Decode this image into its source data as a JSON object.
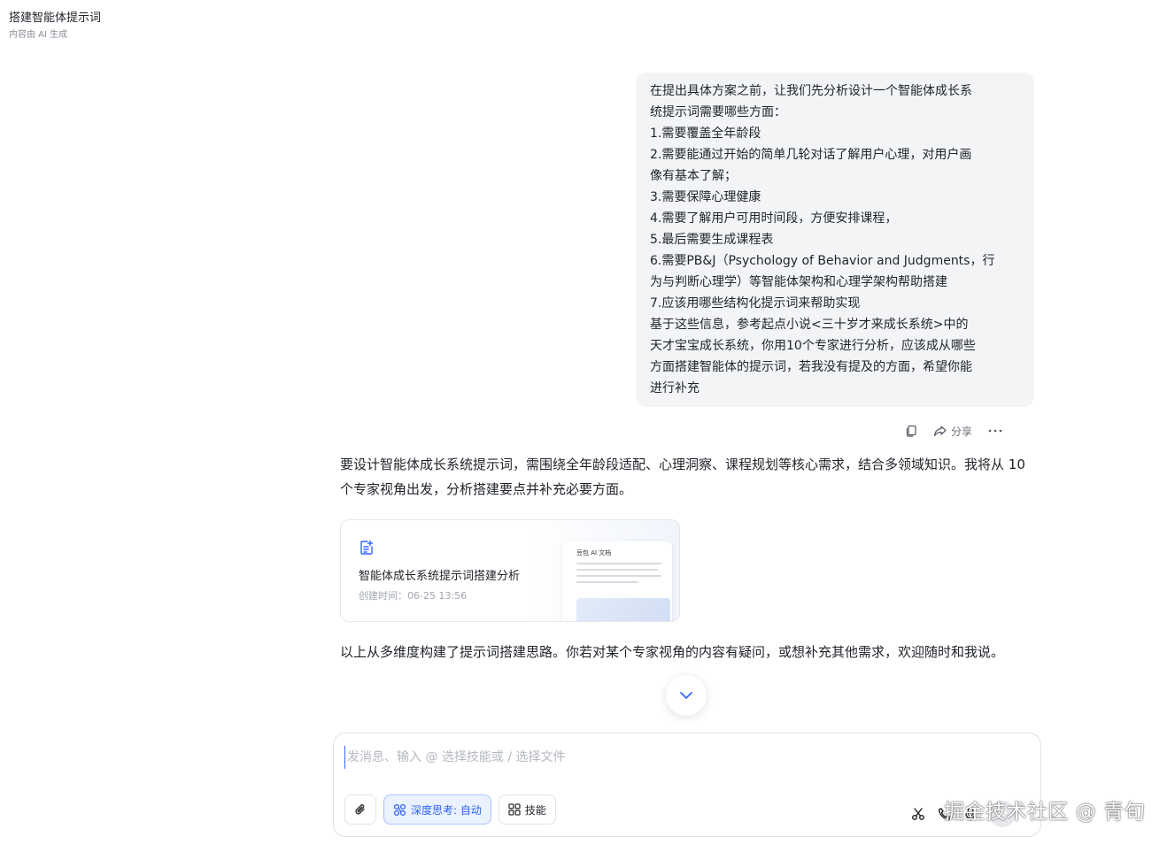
{
  "header": {
    "title": "搭建智能体提示词",
    "subtitle": "内容由 AI 生成"
  },
  "user_message": {
    "lines": [
      "在提出具体方案之前，让我们先分析设计一个智能体成长系",
      "统提示词需要哪些方面：",
      "1.需要覆盖全年龄段",
      "2.需要能通过开始的简单几轮对话了解用户心理，对用户画",
      "像有基本了解；",
      "3.需要保障心理健康",
      "4.需要了解用户可用时间段，方便安排课程，",
      "5.最后需要生成课程表",
      "6.需要PB&J（Psychology of Behavior and Judgments，行",
      "为与判断心理学）等智能体架构和心理学架构帮助搭建",
      "7.应该用哪些结构化提示词来帮助实现",
      "基于这些信息，参考起点小说<三十岁才来成长系统>中的",
      "天才宝宝成长系统，你用10个专家进行分析，应该成从哪些",
      "方面搭建智能体的提示词，若我没有提及的方面，希望你能",
      "进行补充"
    ]
  },
  "message_actions": {
    "share_label": "分享"
  },
  "assistant": {
    "intro": "要设计智能体成长系统提示词，需围绕全年龄段适配、心理洞察、课程规划等核心需求，结合多领域知识。我将从 10 个专家视角出发，分析搭建要点并补充必要方面。",
    "outro": "以上从多维度构建了提示词搭建思路。你若对某个专家视角的内容有疑问，或想补充其他需求，欢迎随时和我说。"
  },
  "doc_card": {
    "name": "智能体成长系统提示词搭建分析",
    "created": "创建时间：06-25 13:56",
    "preview_title": "豆包 AI 文档"
  },
  "composer": {
    "placeholder": "发消息、输入 @ 选择技能或 / 选择文件",
    "deep_think_label": "深度思考: 自动",
    "skills_label": "技能"
  },
  "watermark": "掘金技术社区 @ 青旬",
  "colors": {
    "accent": "#2f63f0",
    "bubble_bg": "#f3f4f6"
  }
}
